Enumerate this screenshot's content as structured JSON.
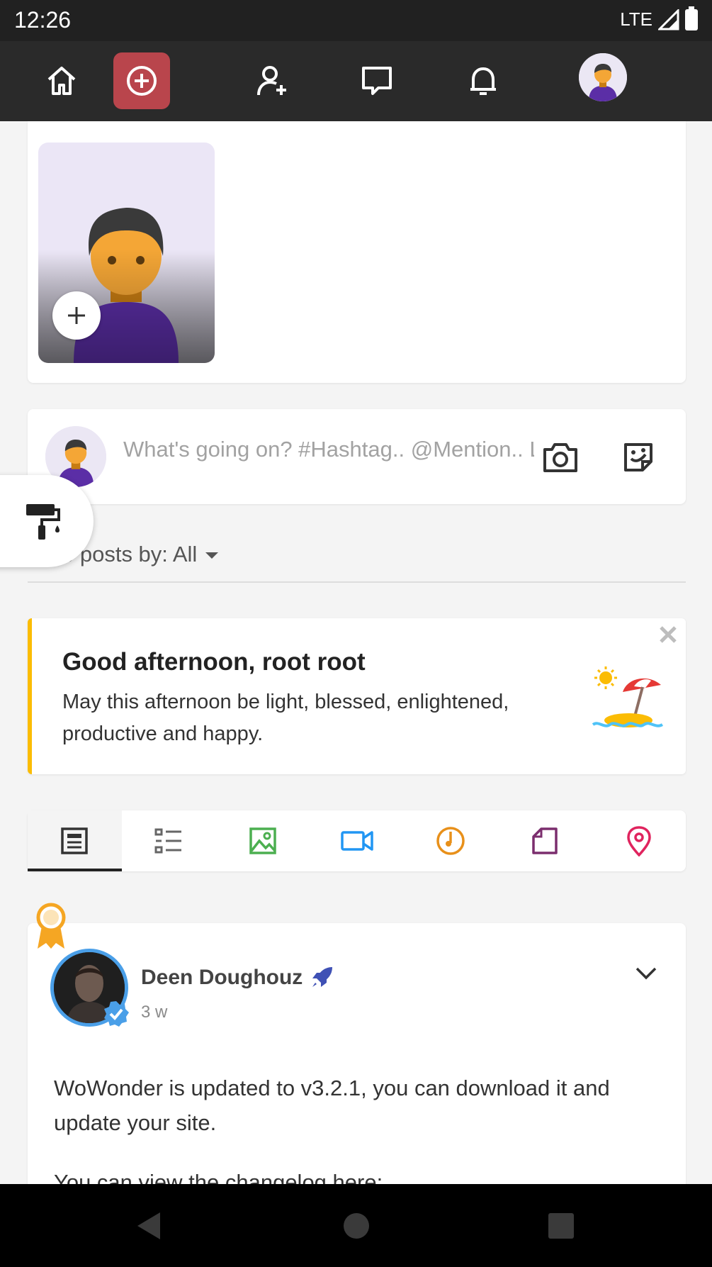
{
  "status_bar": {
    "time": "12:26",
    "network": "LTE"
  },
  "top_nav": {
    "items": [
      "home-icon",
      "create-post-icon",
      "add-friend-icon",
      "messages-icon",
      "notifications-icon",
      "profile-avatar"
    ],
    "active_color": "#b9454c"
  },
  "composer": {
    "placeholder": "What's going on? #Hashtag.. @Mention.. Link.."
  },
  "filter": {
    "label_visible": "e posts by: All"
  },
  "greeting": {
    "title": "Good afternoon, root root",
    "body": "May this afternoon be light, blessed, enlightened, productive and happy.",
    "accent": "#fbbc04"
  },
  "post_tabs": {
    "icons": [
      "news-feed-icon",
      "list-icon",
      "image-icon",
      "video-icon",
      "music-icon",
      "file-icon",
      "location-icon"
    ],
    "colors": [
      "#333333",
      "#555555",
      "#4caf50",
      "#2196f3",
      "#e8901a",
      "#7b2e6e",
      "#e0245e"
    ]
  },
  "post": {
    "author": "Deen Doughouz",
    "time": "3 w",
    "text": "WoWonder is updated to v3.2.1, you can download it and update your site.",
    "text_cut": "You can view the changelog here:"
  }
}
